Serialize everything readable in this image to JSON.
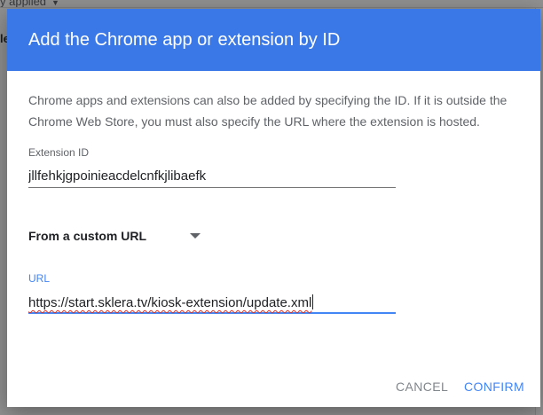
{
  "background": {
    "filter_label": "y applied",
    "edge_label": "le"
  },
  "dialog": {
    "title": "Add the Chrome app or extension by ID",
    "description": "Chrome apps and extensions can also be added by specifying the ID. If it is outside the Chrome Web Store, you must also specify the URL where the extension is hosted.",
    "extension_id": {
      "label": "Extension ID",
      "value": "jllfehkjgpoinieacdelcnfkjlibaefk"
    },
    "source_select": {
      "selected": "From a custom URL"
    },
    "url": {
      "label": "URL",
      "value": "https://start.sklera.tv/kiosk-extension/update.xml"
    },
    "buttons": {
      "cancel": "CANCEL",
      "confirm": "CONFIRM"
    }
  },
  "colors": {
    "header": "#3b78e7",
    "accent": "#4285f4",
    "secondary_text": "#5f6368"
  }
}
